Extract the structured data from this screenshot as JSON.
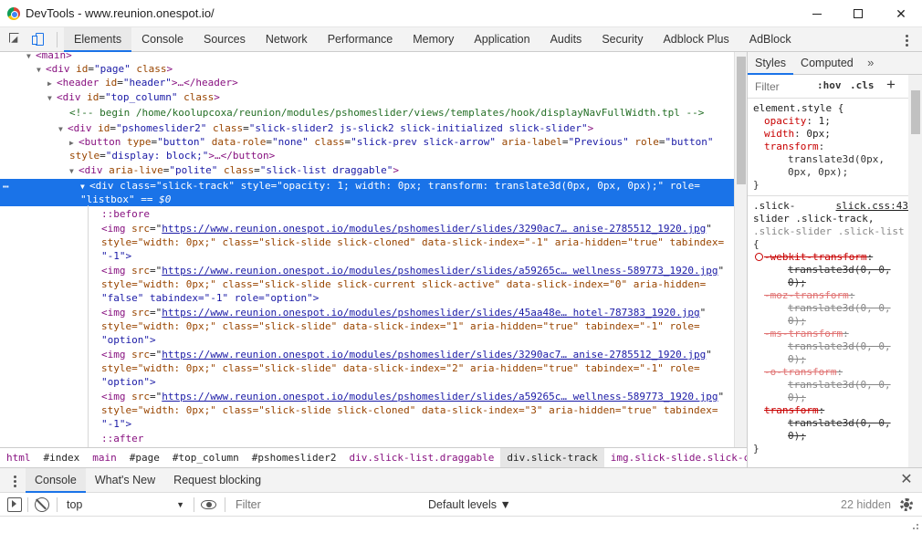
{
  "window": {
    "title": "DevTools - www.reunion.onespot.io/"
  },
  "toolbar": {
    "tabs": [
      "Elements",
      "Console",
      "Sources",
      "Network",
      "Performance",
      "Memory",
      "Application",
      "Audits",
      "Security",
      "Adblock Plus",
      "AdBlock"
    ],
    "active_tab": "Elements"
  },
  "dom": {
    "l0": "<main>",
    "l1_open": "<div ",
    "l1_attr1": "id",
    "l1_val1": "\"page\"",
    "l1_attr2": " class",
    "l1_close": ">",
    "l2_open": "<header ",
    "l2_attr": "id",
    "l2_val": "\"header\"",
    "l2_rest": ">…</header>",
    "l3_open": "<div ",
    "l3_attr1": "id",
    "l3_val1": "\"top_column\"",
    "l3_attr2": " class",
    "l3_close": ">",
    "l4_comment": "<!-- begin /home/koolupcoxa/reunion/modules/pshomeslider/views/templates/hook/displayNavFullWidth.tpl -->",
    "l5_open": "<div ",
    "l5_attr1": "id",
    "l5_val1": "\"pshomeslider2\"",
    "l5_attr2": " class",
    "l5_val2": "\"slick-slider2 js-slick2 slick-initialized slick-slider\"",
    "l5_close": ">",
    "l6_open": "<button ",
    "l6_a1": "type",
    "l6_v1": "\"button\"",
    "l6_a2": " data-role",
    "l6_v2": "\"none\"",
    "l6_a3": " class",
    "l6_v3": "\"slick-prev slick-arrow\"",
    "l6_a4": " aria-label",
    "l6_v4": "\"Previous\"",
    "l6_a5": " role",
    "l6_v5": "\"button\"",
    "l6b_a": "style",
    "l6b_v": "\"display: block;\"",
    "l6b_rest": ">…</button>",
    "l7_open": "<div ",
    "l7_a1": "aria-live",
    "l7_v1": "\"polite\"",
    "l7_a2": " class",
    "l7_v2": "\"slick-list draggable\"",
    "l7_close": ">",
    "sel_line1": "<div class=\"slick-track\" style=\"opacity: 1; width: 0px; transform: translate3d(0px, 0px, 0px);\" role=",
    "sel_line2": "\"listbox\"",
    "sel_eq": " == $0",
    "before": "::before",
    "after": "::after",
    "img": [
      {
        "url": "https://www.reunion.onespot.io/modules/pshomeslider/slides/3290ac7… anise-2785512_1920.jpg",
        "l2": "style=\"width: 0px;\" class=\"slick-slide slick-cloned\" data-slick-index=\"-1\" aria-hidden=\"true\" tabindex=",
        "l3": "\"-1\">"
      },
      {
        "url": "https://www.reunion.onespot.io/modules/pshomeslider/slides/a59265c… wellness-589773_1920.jpg",
        "l2": "style=\"width: 0px;\" class=\"slick-slide slick-current slick-active\" data-slick-index=\"0\" aria-hidden=",
        "l3": "\"false\" tabindex=\"-1\" role=\"option\">"
      },
      {
        "url": "https://www.reunion.onespot.io/modules/pshomeslider/slides/45aa48e… hotel-787383_1920.jpg",
        "l2": "style=\"width: 0px;\" class=\"slick-slide\" data-slick-index=\"1\" aria-hidden=\"true\" tabindex=\"-1\" role=",
        "l3": "\"option\">"
      },
      {
        "url": "https://www.reunion.onespot.io/modules/pshomeslider/slides/3290ac7… anise-2785512_1920.jpg",
        "l2": "style=\"width: 0px;\" class=\"slick-slide\" data-slick-index=\"2\" aria-hidden=\"true\" tabindex=\"-1\" role=",
        "l3": "\"option\">"
      },
      {
        "url": "https://www.reunion.onespot.io/modules/pshomeslider/slides/a59265c… wellness-589773_1920.jpg",
        "l2": "style=\"width: 0px;\" class=\"slick-slide slick-cloned\" data-slick-index=\"3\" aria-hidden=\"true\" tabindex=",
        "l3": "\"-1\">"
      }
    ],
    "img_prefix": "<img ",
    "img_src_attr": "src",
    "img_src_q_open": "=\"",
    "img_src_q_close": "\""
  },
  "breadcrumb": [
    "html",
    "#index",
    "main",
    "#page",
    "#top_column",
    "#pshomeslider2",
    "div.slick-list.draggable",
    "div.slick-track",
    "img.slick-slide.slick-cloned"
  ],
  "styles": {
    "tabs": [
      "Styles",
      "Computed"
    ],
    "more": "»",
    "filter_placeholder": "Filter",
    "hov": ":hov",
    ".cls": ".cls",
    "plus": "+",
    "rule1_selector": "element.style {",
    "rule1_props": [
      {
        "name": "opacity",
        "value": "1;"
      },
      {
        "name": "width",
        "value": "0px;"
      },
      {
        "name": "transform",
        "value": ""
      }
    ],
    "rule1_value_cont1": "translate3d(0px,",
    "rule1_value_cont2": "0px, 0px);",
    "close": "}",
    "rule2_sel1": ".slick-",
    "rule2_source": "slick.css:43",
    "rule2_sel2": "slider .slick-track,",
    "rule2_sel3": ".slick-slider .slick-list",
    "rule2_open": "{",
    "rule2_props": [
      {
        "name": "-webkit-transform",
        "value": "translate3d(0, 0,",
        "cont": "0);"
      },
      {
        "name": "-moz-transform",
        "value": "translate3d(0, 0,",
        "cont": "0);"
      },
      {
        "name": "-ms-transform",
        "value": "translate3d(0, 0,",
        "cont": "0);"
      },
      {
        "name": "-o-transform",
        "value": "translate3d(0, 0,",
        "cont": "0);"
      },
      {
        "name": "transform",
        "value": "translate3d(0, 0,",
        "cont": "0);"
      }
    ]
  },
  "drawer": {
    "tabs": [
      "Console",
      "What's New",
      "Request blocking"
    ],
    "active_tab": "Console",
    "context": "top",
    "filter_placeholder": "Filter",
    "levels": "Default levels ▼",
    "hidden": "22 hidden"
  },
  "icons": {
    "inspect": "inspect-element-icon",
    "device": "device-toolbar-icon",
    "more": "kebab-menu-icon",
    "close": "close-icon",
    "gear": "gear-icon",
    "eye": "eye-icon",
    "clear": "clear-console-icon",
    "sidebar": "console-sidebar-icon"
  },
  "colors": {
    "accent": "#1a73e8",
    "tag": "#881280",
    "attr": "#994500",
    "value": "#1a1aa6",
    "comment": "#236e25",
    "css_prop": "#c80000"
  }
}
